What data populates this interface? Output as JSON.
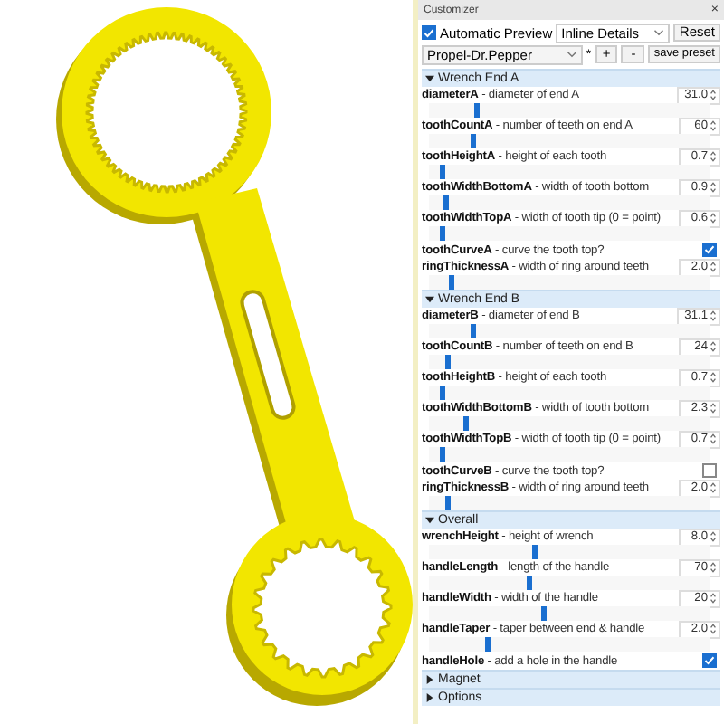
{
  "window": {
    "title": "Customizer",
    "close": "×"
  },
  "toolbar": {
    "auto_preview": {
      "label": "Automatic Preview",
      "checked": true
    },
    "detail_mode": "Inline Details",
    "reset": "Reset"
  },
  "preset_bar": {
    "preset": "Propel-Dr.Pepper",
    "marker": "*",
    "add": "+",
    "remove": "-",
    "save": "save preset"
  },
  "groups": [
    {
      "title": "Wrench End A",
      "expanded": true,
      "params": [
        {
          "kind": "slider",
          "label": "**diameterA** - diameter of end A",
          "value": "31.0",
          "level": 0.16
        },
        {
          "kind": "slider",
          "label": "**toothCountA** - number of teeth on end A",
          "value": "60",
          "level": 0.15
        },
        {
          "kind": "slider",
          "label": "**toothHeightA** - height of each tooth",
          "value": "0.7",
          "level": 0.04
        },
        {
          "kind": "slider",
          "label": "**toothWidthBottomA** - width of tooth bottom",
          "value": "0.9",
          "level": 0.05
        },
        {
          "kind": "slider",
          "label": "**toothWidthTopA** - width of tooth tip (0 = point)",
          "value": "0.6",
          "level": 0.04
        },
        {
          "kind": "checkbox",
          "label": "**toothCurveA** - curve the tooth top?",
          "checked": true
        },
        {
          "kind": "slider",
          "label": "**ringThicknessA** - width of ring around teeth",
          "value": "2.0",
          "level": 0.07
        }
      ]
    },
    {
      "title": "Wrench End B",
      "expanded": true,
      "params": [
        {
          "kind": "slider",
          "label": "**diameterB** - diameter of end B",
          "value": "31.1",
          "level": 0.15
        },
        {
          "kind": "slider",
          "label": "**toothCountB** - number of teeth on end B",
          "value": "24",
          "level": 0.06
        },
        {
          "kind": "slider",
          "label": "**toothHeightB** - height of each tooth",
          "value": "0.7",
          "level": 0.04
        },
        {
          "kind": "slider",
          "label": "**toothWidthBottomB** - width of tooth bottom",
          "value": "2.3",
          "level": 0.12
        },
        {
          "kind": "slider",
          "label": "**toothWidthTopB** - width of tooth tip (0 = point)",
          "value": "0.7",
          "level": 0.04
        },
        {
          "kind": "checkbox",
          "label": "**toothCurveB** - curve the tooth top?",
          "checked": false
        },
        {
          "kind": "slider",
          "label": "**ringThicknessB** - width of ring around teeth",
          "value": "2.0",
          "level": 0.06
        }
      ]
    },
    {
      "title": "Overall",
      "expanded": true,
      "params": [
        {
          "kind": "slider",
          "label": "**wrenchHeight** - height of wrench",
          "value": "8.0",
          "level": 0.37
        },
        {
          "kind": "slider",
          "label": "**handleLength** - length of the handle",
          "value": "70",
          "level": 0.35
        },
        {
          "kind": "slider",
          "label": "**handleWidth** - width of the handle",
          "value": "20",
          "level": 0.4
        },
        {
          "kind": "slider",
          "label": "**handleTaper** - taper between end & handle",
          "value": "2.0",
          "level": 0.2
        },
        {
          "kind": "checkbox",
          "label": "**handleHole** - add a hole in the handle",
          "checked": true
        }
      ]
    },
    {
      "title": "Magnet",
      "expanded": false
    },
    {
      "title": "Options",
      "expanded": false
    }
  ]
}
